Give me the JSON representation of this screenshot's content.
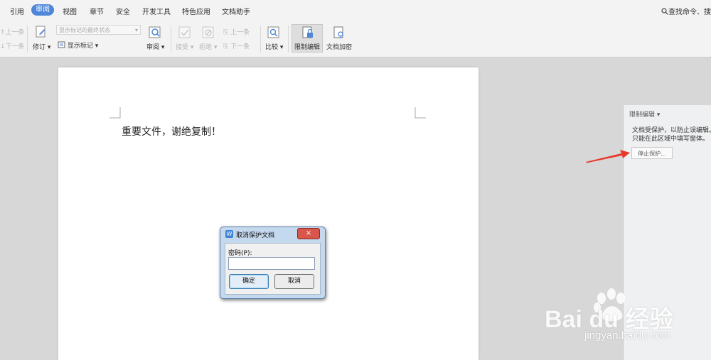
{
  "menu": {
    "items": [
      "引用",
      "审阅",
      "视图",
      "章节",
      "安全",
      "开发工具",
      "特色应用",
      "文档助手"
    ],
    "active": "审阅",
    "search_label": "查找命令、搜"
  },
  "toolbar": {
    "prev_item_left": "上一条",
    "next_item_left": "下一条",
    "markup_state_select": "显示标记的最终状态",
    "track_changes": "修订",
    "show_markup": "显示标记",
    "review": "审阅",
    "accept": "接受",
    "reject": "拒绝",
    "prev_item": "上一条",
    "next_item": "下一条",
    "compare": "比较",
    "restrict_editing": "限制编辑",
    "encrypt_doc": "文档加密",
    "accent_color": "#4e86d9"
  },
  "document": {
    "body_text": "重要文件，谢绝复制！"
  },
  "side_panel": {
    "title": "限制编辑",
    "line1": "文档受保护，以防止误编辑。",
    "line2": "只能在此区域中填写窗体。",
    "stop_button": "停止保护..."
  },
  "dialog": {
    "title": "取消保护文档",
    "close_glyph": "×",
    "password_label": "密码(P):",
    "password_value": "",
    "ok_label": "确定",
    "cancel_label": "取消"
  },
  "watermark": {
    "brand": "Bai du 经验",
    "url": "jingyan.baidu.com"
  },
  "arrow_color": "#e8392b"
}
